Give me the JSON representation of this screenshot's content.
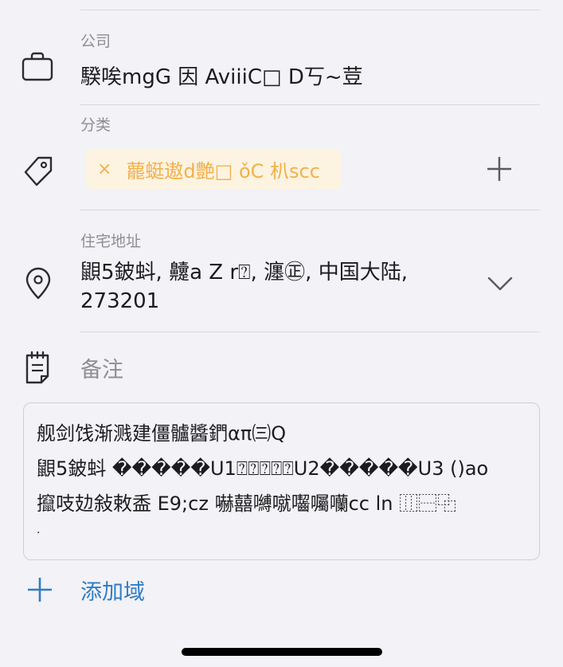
{
  "company": {
    "label": "公司",
    "value": "騤唉mgG 因 AviiiC□ D丂~荳"
  },
  "category": {
    "label": "分类",
    "tag_remove": "×",
    "tag_text": "藣蜓遨d艶□ ǒC 朳scc",
    "add_icon": "plus-icon"
  },
  "address": {
    "label": "住宅地址",
    "line1": "鼰5鈹蚪, 䶑a Z r⍰, 瀍㊣, 中国大陆,",
    "line2": "273201"
  },
  "notes": {
    "label": "备注",
    "lines": [
      "舰剑饯渐溅建僵髗醬鍆απ㈢Q",
      "鼰5鈹蚪 �����U1⍰⍰⍰⍰⍰U2�����U3   ()ao",
      "攛吱攰敍敕盉 E9;cz 嚇囍嚩噈囓囑囒cc ln ⿲⿱⿻",
      "                ."
    ]
  },
  "add_field": {
    "label": "添加域"
  },
  "colors": {
    "background": "#f2f2f7",
    "accent_blue": "#2f7dc4",
    "tag_text": "#f2b04b",
    "tag_bg": "#fdf3e1",
    "secondary_text": "#8e8e93"
  }
}
